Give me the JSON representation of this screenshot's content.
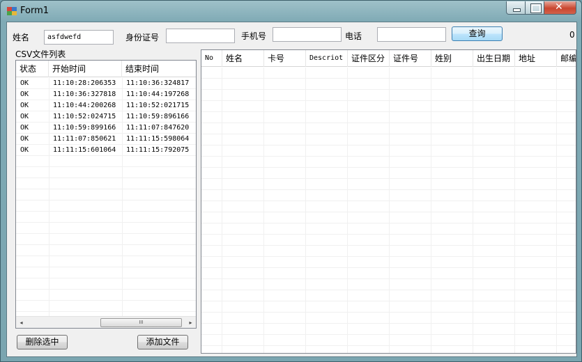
{
  "window": {
    "title": "Form1"
  },
  "form": {
    "name_label": "姓名",
    "name_value": "asfdwefd",
    "id_label": "身份证号",
    "id_value": "",
    "mobile_label": "手机号",
    "mobile_value": "",
    "phone_label": "电话",
    "phone_value": "",
    "query_button": "查询",
    "count": "0"
  },
  "csv_list": {
    "group_label": "CSV文件列表",
    "columns": [
      "状态",
      "开始时间",
      "结束时间"
    ],
    "rows": [
      [
        "OK",
        "11:10:28:206353",
        "11:10:36:324817"
      ],
      [
        "OK",
        "11:10:36:327818",
        "11:10:44:197268"
      ],
      [
        "OK",
        "11:10:44:200268",
        "11:10:52:021715"
      ],
      [
        "OK",
        "11:10:52:024715",
        "11:10:59:896166"
      ],
      [
        "OK",
        "11:10:59:899166",
        "11:11:07:847620"
      ],
      [
        "OK",
        "11:11:07:850621",
        "11:11:15:598064"
      ],
      [
        "OK",
        "11:11:15:601064",
        "11:11:15:792075"
      ]
    ],
    "scroll_left": "◂",
    "scroll_right": "▸",
    "scroll_thumb": "III"
  },
  "results": {
    "columns": [
      "No",
      "姓名",
      "卡号",
      "Descriot",
      "证件区分",
      "证件号",
      "姓别",
      "出生日期",
      "地址",
      "邮编"
    ]
  },
  "buttons": {
    "delete_selected": "删除选中",
    "add_file": "添加文件"
  }
}
